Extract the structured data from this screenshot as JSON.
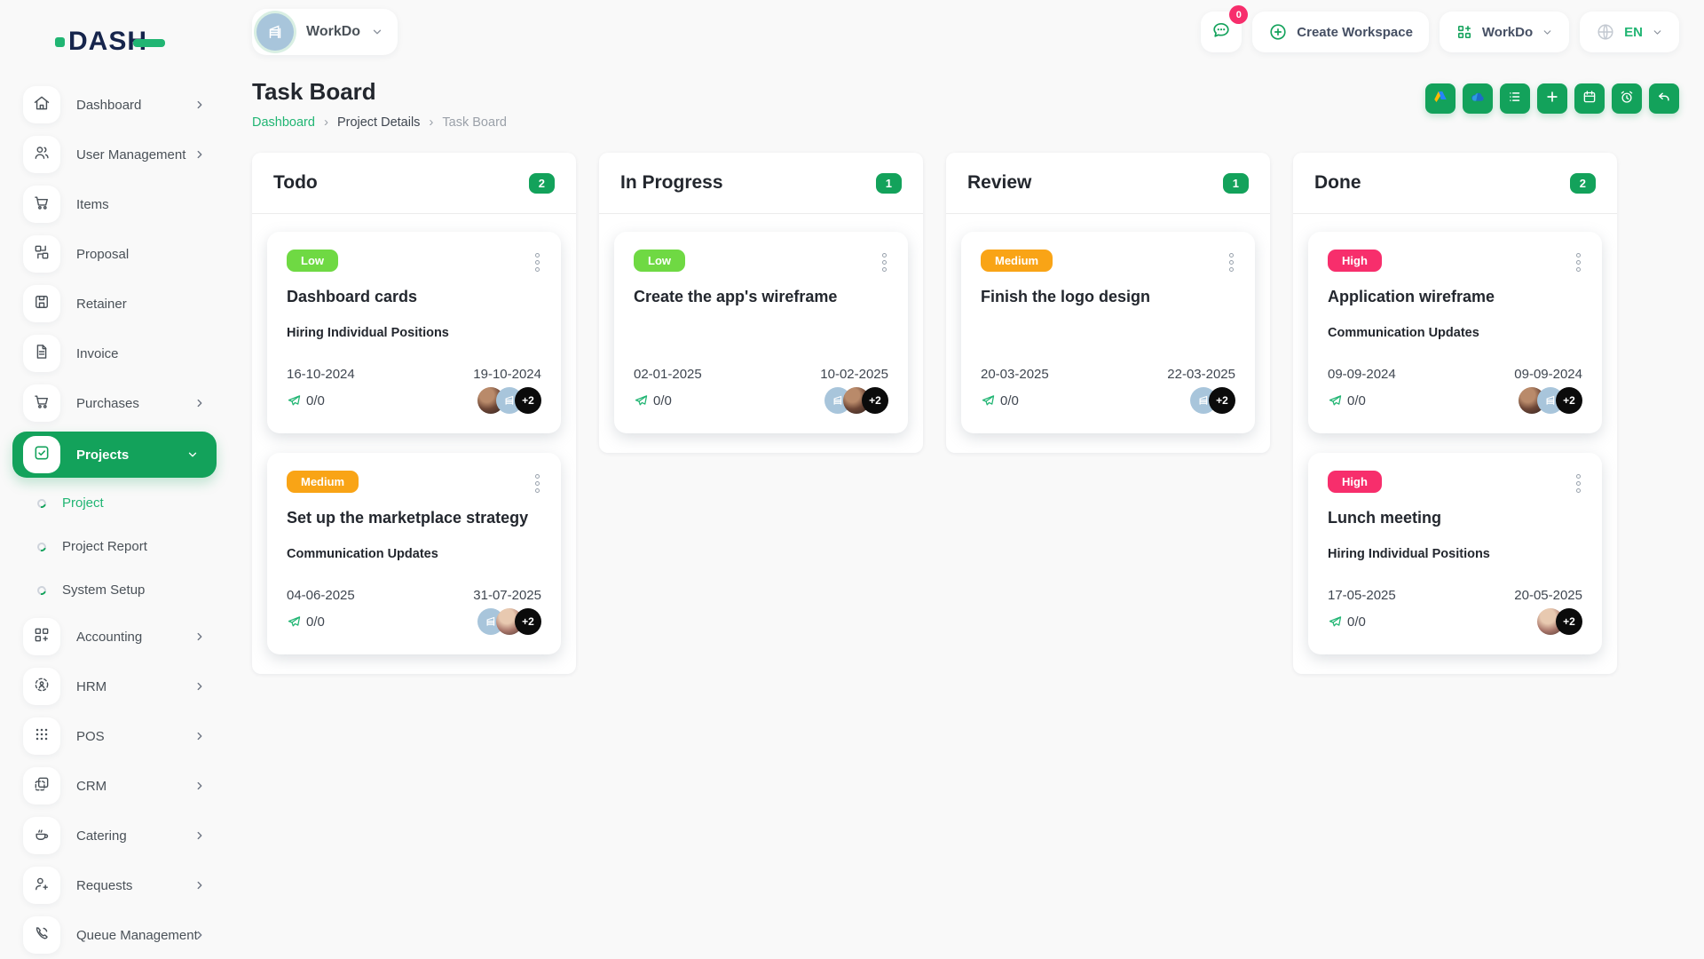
{
  "brand": {
    "logo_text": "DASH"
  },
  "workspace": {
    "name": "WorkDo"
  },
  "header": {
    "messages_badge": "0",
    "create_workspace_label": "Create Workspace",
    "workdo_label": "WorkDo",
    "language": "EN"
  },
  "sidebar": {
    "items": [
      {
        "label": "Dashboard"
      },
      {
        "label": "User Management"
      },
      {
        "label": "Items"
      },
      {
        "label": "Proposal"
      },
      {
        "label": "Retainer"
      },
      {
        "label": "Invoice"
      },
      {
        "label": "Purchases"
      },
      {
        "label": "Projects"
      },
      {
        "label": "Accounting"
      },
      {
        "label": "HRM"
      },
      {
        "label": "POS"
      },
      {
        "label": "CRM"
      },
      {
        "label": "Catering"
      },
      {
        "label": "Requests"
      },
      {
        "label": "Queue Management"
      }
    ],
    "submenu": [
      {
        "label": "Project"
      },
      {
        "label": "Project Report"
      },
      {
        "label": "System Setup"
      }
    ]
  },
  "page": {
    "title": "Task Board",
    "breadcrumb": [
      "Dashboard",
      "Project Details",
      "Task Board"
    ],
    "breadcrumb_separator": "›"
  },
  "board": {
    "columns": [
      {
        "title": "Todo",
        "count": "2",
        "cards": [
          {
            "priority": "Low",
            "title": "Dashboard cards",
            "milestone": "Hiring Individual Positions",
            "start_date": "16-10-2024",
            "end_date": "19-10-2024",
            "progress": "0/0",
            "extra_members": "+2"
          },
          {
            "priority": "Medium",
            "title": "Set up the marketplace strategy",
            "milestone": "Communication Updates",
            "start_date": "04-06-2025",
            "end_date": "31-07-2025",
            "progress": "0/0",
            "extra_members": "+2"
          }
        ]
      },
      {
        "title": "In Progress",
        "count": "1",
        "cards": [
          {
            "priority": "Low",
            "title": "Create the app's wireframe",
            "milestone": "",
            "start_date": "02-01-2025",
            "end_date": "10-02-2025",
            "progress": "0/0",
            "extra_members": "+2"
          }
        ]
      },
      {
        "title": "Review",
        "count": "1",
        "cards": [
          {
            "priority": "Medium",
            "title": "Finish the logo design",
            "milestone": "",
            "start_date": "20-03-2025",
            "end_date": "22-03-2025",
            "progress": "0/0",
            "extra_members": "+2"
          }
        ]
      },
      {
        "title": "Done",
        "count": "2",
        "cards": [
          {
            "priority": "High",
            "title": "Application wireframe",
            "milestone": "Communication Updates",
            "start_date": "09-09-2024",
            "end_date": "09-09-2024",
            "progress": "0/0",
            "extra_members": "+2"
          },
          {
            "priority": "High",
            "title": "Lunch meeting",
            "milestone": "Hiring Individual Positions",
            "start_date": "17-05-2025",
            "end_date": "20-05-2025",
            "progress": "0/0",
            "extra_members": "+2"
          }
        ]
      }
    ]
  },
  "colors": {
    "primary_green": "#13a25b",
    "link_green": "#21b573",
    "priority_low": "#6fd943",
    "priority_medium": "#f9a416",
    "priority_high": "#f72e6c",
    "notification_badge": "#f72e6c",
    "avatar_logo_bg": "#a8c5db",
    "more_chip_bg": "#0b0b0b",
    "logo_navy": "#16254c"
  }
}
